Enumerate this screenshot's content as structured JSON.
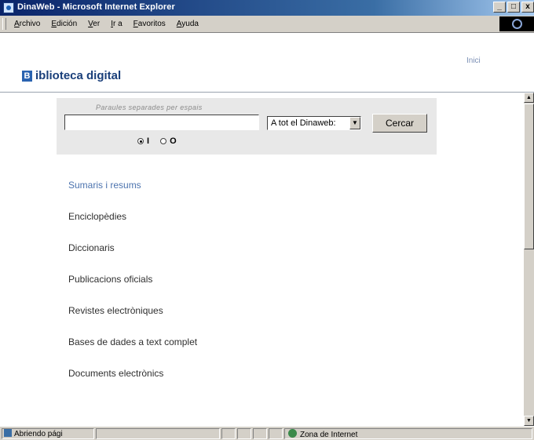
{
  "window": {
    "title": "DinaWeb - Microsoft Internet Explorer",
    "controls": {
      "minimize": "_",
      "maximize": "□",
      "close": "x"
    }
  },
  "menu": {
    "items": [
      "Archivo",
      "Edición",
      "Ver",
      "Ir a",
      "Favoritos",
      "Ayuda"
    ]
  },
  "header": {
    "logo_letter": "B",
    "logo_text": "iblioteca digital",
    "home_link": "Inici"
  },
  "search": {
    "hint": "Paraules separades per espais",
    "input_value": "",
    "scope_selected": "A tot el Dinaweb:",
    "button_label": "Cercar",
    "options": [
      {
        "label": "I",
        "checked": true
      },
      {
        "label": "O",
        "checked": false
      }
    ]
  },
  "links": [
    "Sumaris i resums",
    "Enciclopèdies",
    "Diccionaris",
    "Publicacions oficials",
    "Revistes electròniques",
    "Bases de dades a text complet",
    "Documents electrònics"
  ],
  "status": {
    "message": "Abriendo pági",
    "zone": "Zona de Internet"
  },
  "colors": {
    "title_bar": "#0a246a",
    "link_active": "#4c73ae",
    "chrome": "#d4d0c8"
  }
}
